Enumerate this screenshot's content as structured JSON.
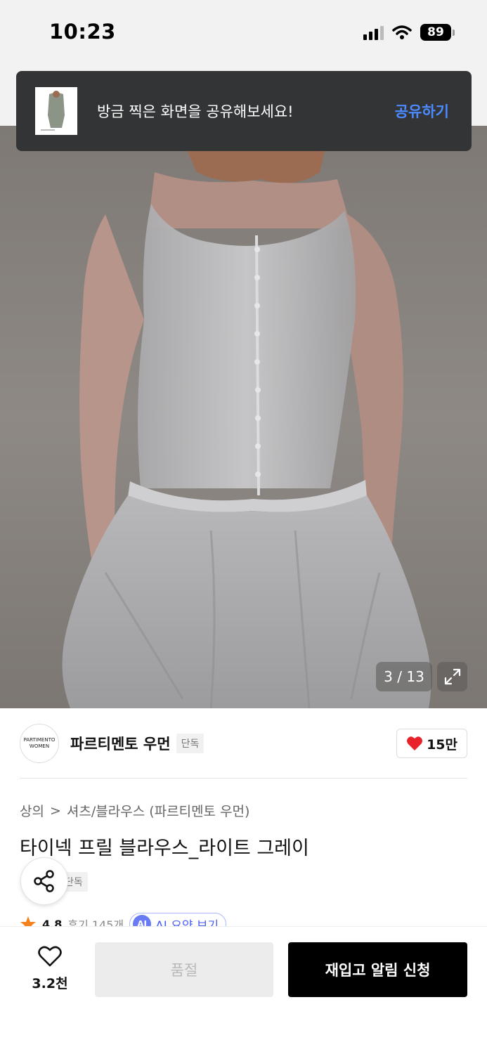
{
  "status_bar": {
    "time": "10:23",
    "battery": "89"
  },
  "toast": {
    "message": "방금 찍은 화면을 공유해보세요!",
    "action": "공유하기"
  },
  "gallery": {
    "counter": "3 / 13"
  },
  "brand": {
    "logo_line1": "PARTIMENTO",
    "logo_line2": "WOMEN",
    "name": "파르티멘토 우먼",
    "tag": "단독",
    "likes": "15만"
  },
  "breadcrumb": {
    "category": "상의",
    "separator": ">",
    "subcategory": "셔츠/블라우스 (파르티멘토 우먼)"
  },
  "product": {
    "title": "타이넥 프릴 블라우스_라이트 그레이",
    "tag": "단독"
  },
  "rating": {
    "score": "4.8",
    "reviews": "후기 145개",
    "ai_badge": "AI",
    "ai_label": "AI 요약 보기"
  },
  "bottom_bar": {
    "wish_count": "3.2천",
    "soldout_label": "품절",
    "restock_label": "재입고 알림 신청"
  },
  "colors": {
    "accent_blue": "#4b8bff",
    "heart_red": "#e8212b",
    "star_orange": "#f5821f"
  }
}
